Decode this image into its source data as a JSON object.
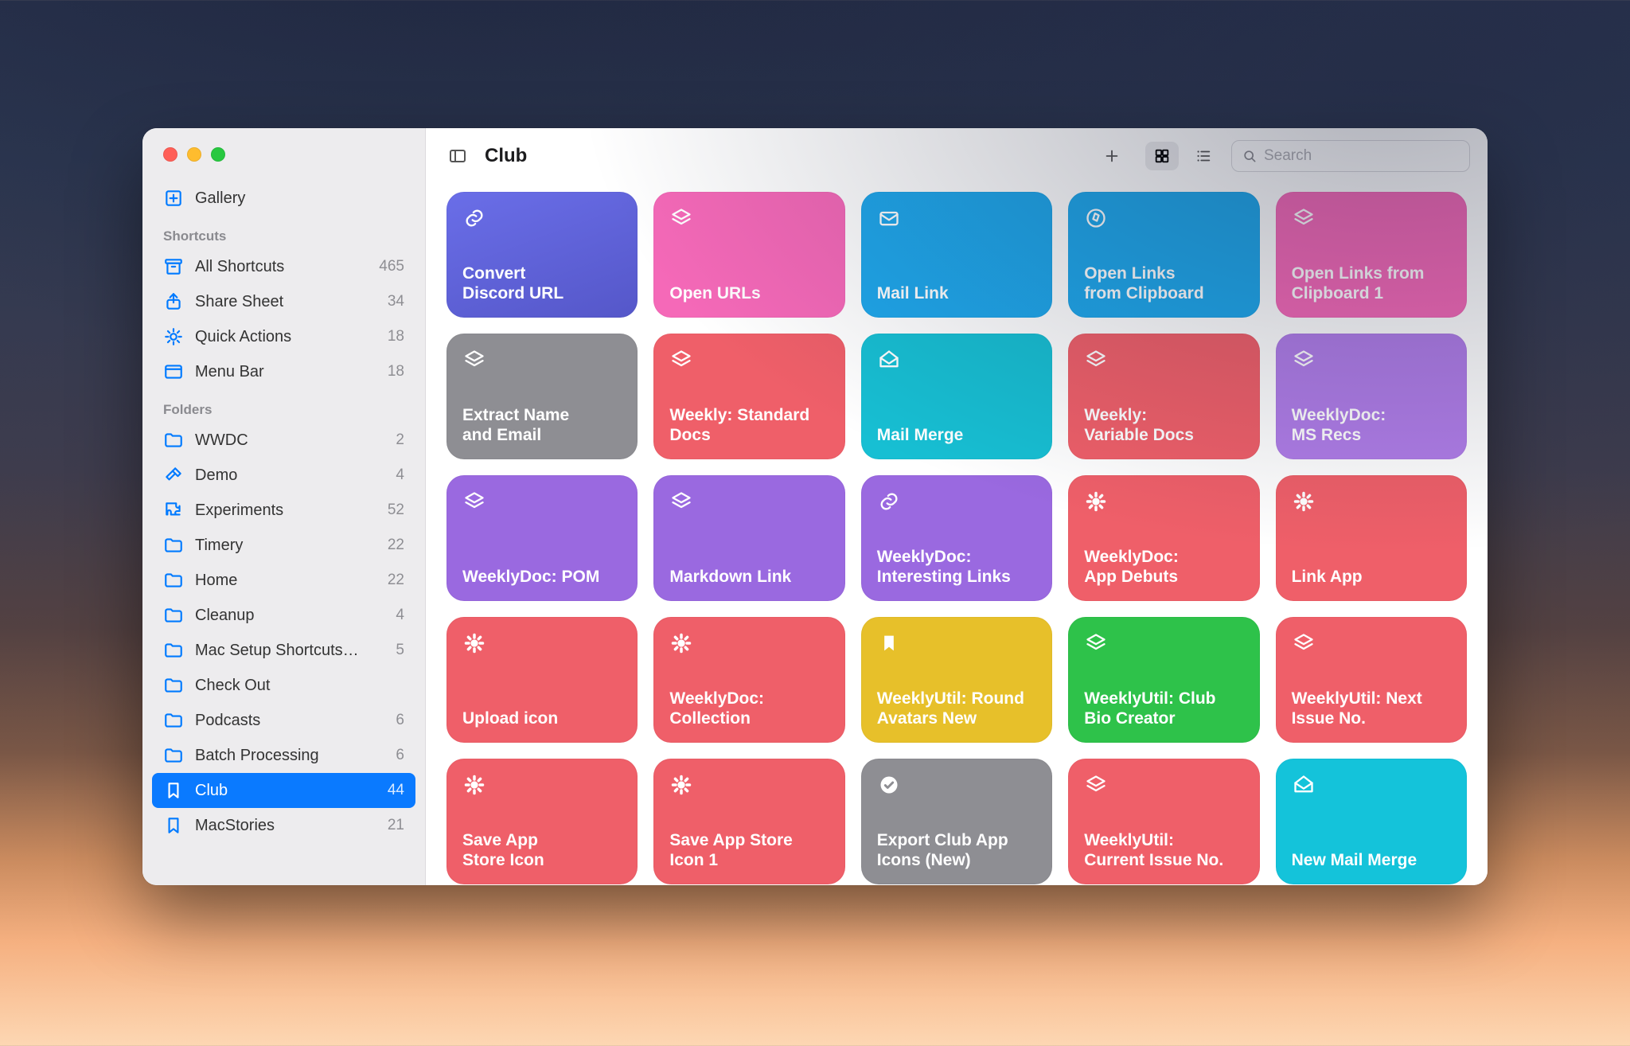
{
  "title": "Club",
  "search_placeholder": "Search",
  "gallery_label": "Gallery",
  "sections": {
    "shortcuts_header": "Shortcuts",
    "folders_header": "Folders"
  },
  "sidebar_shortcuts": [
    {
      "label": "All Shortcuts",
      "count": "465",
      "icon": "archive"
    },
    {
      "label": "Share Sheet",
      "count": "34",
      "icon": "share"
    },
    {
      "label": "Quick Actions",
      "count": "18",
      "icon": "gear"
    },
    {
      "label": "Menu Bar",
      "count": "18",
      "icon": "menubar"
    }
  ],
  "sidebar_folders": [
    {
      "label": "WWDC",
      "count": "2",
      "icon": "folder"
    },
    {
      "label": "Demo",
      "count": "4",
      "icon": "hammer"
    },
    {
      "label": "Experiments",
      "count": "52",
      "icon": "puzzle"
    },
    {
      "label": "Timery",
      "count": "22",
      "icon": "folder"
    },
    {
      "label": "Home",
      "count": "22",
      "icon": "folder"
    },
    {
      "label": "Cleanup",
      "count": "4",
      "icon": "folder"
    },
    {
      "label": "Mac Setup Shortcuts…",
      "count": "5",
      "icon": "folder"
    },
    {
      "label": "Check Out",
      "count": "",
      "icon": "folder"
    },
    {
      "label": "Podcasts",
      "count": "6",
      "icon": "folder"
    },
    {
      "label": "Batch Processing",
      "count": "6",
      "icon": "folder"
    },
    {
      "label": "Club",
      "count": "44",
      "icon": "bookmark",
      "selected": true
    },
    {
      "label": "MacStories",
      "count": "21",
      "icon": "bookmark"
    }
  ],
  "tiles": [
    {
      "label": "Convert\nDiscord URL",
      "color": "c-indigo",
      "icon": "link"
    },
    {
      "label": "Open URLs",
      "color": "c-pink",
      "icon": "stack"
    },
    {
      "label": "Mail Link",
      "color": "c-blue",
      "icon": "envelope"
    },
    {
      "label": "Open Links\nfrom Clipboard",
      "color": "c-blue",
      "icon": "compass"
    },
    {
      "label": "Open Links from\nClipboard 1",
      "color": "c-pink",
      "icon": "stack"
    },
    {
      "label": "Extract Name\nand Email",
      "color": "c-gray",
      "icon": "stack"
    },
    {
      "label": "Weekly: Standard\nDocs",
      "color": "c-red",
      "icon": "stack"
    },
    {
      "label": "Mail Merge",
      "color": "c-teal",
      "icon": "envelope-open"
    },
    {
      "label": "Weekly:\nVariable Docs",
      "color": "c-red",
      "icon": "stack"
    },
    {
      "label": "WeeklyDoc:\nMS Recs",
      "color": "c-purplel",
      "icon": "stack"
    },
    {
      "label": "WeeklyDoc: POM",
      "color": "c-purple",
      "icon": "stack"
    },
    {
      "label": "Markdown Link",
      "color": "c-purple",
      "icon": "stack"
    },
    {
      "label": "WeeklyDoc:\nInteresting Links",
      "color": "c-purple",
      "icon": "link"
    },
    {
      "label": "WeeklyDoc:\nApp Debuts",
      "color": "c-red",
      "icon": "gear-fill"
    },
    {
      "label": "Link App",
      "color": "c-red",
      "icon": "gear-fill"
    },
    {
      "label": "Upload icon",
      "color": "c-red",
      "icon": "gear-fill"
    },
    {
      "label": "WeeklyDoc:\nCollection",
      "color": "c-red",
      "icon": "gear-fill"
    },
    {
      "label": "WeeklyUtil: Round\nAvatars New",
      "color": "c-yellow",
      "icon": "bookmark-fill"
    },
    {
      "label": "WeeklyUtil: Club\nBio Creator",
      "color": "c-green",
      "icon": "stack"
    },
    {
      "label": "WeeklyUtil: Next\nIssue No.",
      "color": "c-red",
      "icon": "stack"
    },
    {
      "label": "Save App\nStore Icon",
      "color": "c-red",
      "icon": "gear-fill"
    },
    {
      "label": "Save App Store\nIcon 1",
      "color": "c-red",
      "icon": "gear-fill"
    },
    {
      "label": "Export Club App\nIcons (New)",
      "color": "c-gray",
      "icon": "check"
    },
    {
      "label": "WeeklyUtil:\nCurrent Issue No.",
      "color": "c-red",
      "icon": "stack"
    },
    {
      "label": "New Mail Merge",
      "color": "c-cyan",
      "icon": "envelope-open"
    }
  ]
}
